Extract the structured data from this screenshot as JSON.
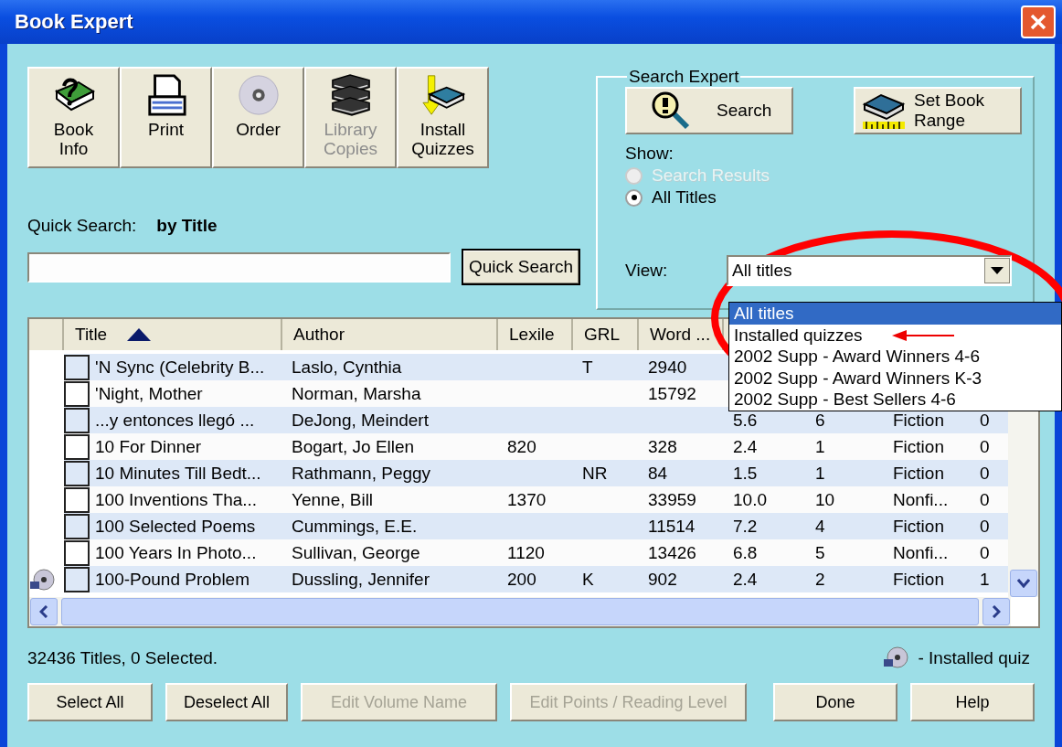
{
  "window": {
    "title": "Book Expert"
  },
  "toolbar": [
    {
      "kind": "book-info",
      "lines": [
        "Book",
        "Info"
      ],
      "disabled": false
    },
    {
      "kind": "print",
      "lines": [
        "Print"
      ],
      "disabled": false
    },
    {
      "kind": "order",
      "lines": [
        "Order"
      ],
      "disabled": false
    },
    {
      "kind": "library",
      "lines": [
        "Library",
        "Copies"
      ],
      "disabled": true
    },
    {
      "kind": "install",
      "lines": [
        "Install",
        "Quizzes"
      ],
      "disabled": false
    }
  ],
  "quick_search": {
    "label": "Quick Search:",
    "mode": "by Title",
    "button": "Quick Search"
  },
  "search_expert": {
    "title": "Search Expert",
    "search_button": "Search",
    "range_button": "Set Book Range",
    "show_label": "Show:",
    "options": [
      {
        "label": "Search Results",
        "selected": false,
        "disabled": true
      },
      {
        "label": "All Titles",
        "selected": true,
        "disabled": false
      }
    ],
    "view_label": "View:",
    "view_value": "All titles",
    "view_options": [
      {
        "label": "All titles",
        "selected": true
      },
      {
        "label": "Installed quizzes",
        "selected": false
      },
      {
        "label": "2002 Supp - Award Winners 4-6",
        "selected": false
      },
      {
        "label": "2002 Supp - Award Winners K-3",
        "selected": false
      },
      {
        "label": "2002 Supp - Best Sellers 4-6",
        "selected": false
      }
    ]
  },
  "table": {
    "columns": [
      {
        "label": "Title",
        "sorted": true
      },
      {
        "label": "Author"
      },
      {
        "label": "Lexile"
      },
      {
        "label": "GRL"
      },
      {
        "label": "Word ..."
      }
    ],
    "rows": [
      {
        "installed": false,
        "checked": false,
        "cells": [
          "'N Sync (Celebrity B...",
          "Laslo, Cynthia",
          null,
          "T",
          "2940",
          null,
          null,
          null,
          null
        ]
      },
      {
        "installed": false,
        "checked": false,
        "cells": [
          "'Night, Mother",
          "Norman, Marsha",
          null,
          null,
          "15792",
          null,
          null,
          null,
          null
        ]
      },
      {
        "installed": false,
        "checked": false,
        "cells": [
          "...y entonces llegó ...",
          "DeJong, Meindert",
          null,
          null,
          null,
          "5.6",
          "6",
          "Fiction",
          "0"
        ]
      },
      {
        "installed": false,
        "checked": false,
        "cells": [
          "10 For Dinner",
          "Bogart, Jo Ellen",
          "820",
          null,
          "328",
          "2.4",
          "1",
          "Fiction",
          "0"
        ]
      },
      {
        "installed": false,
        "checked": false,
        "cells": [
          "10 Minutes Till Bedt...",
          "Rathmann, Peggy",
          null,
          "NR",
          "84",
          "1.5",
          "1",
          "Fiction",
          "0"
        ]
      },
      {
        "installed": false,
        "checked": false,
        "cells": [
          "100 Inventions Tha...",
          "Yenne, Bill",
          "1370",
          null,
          "33959",
          "10.0",
          "10",
          "Nonfi...",
          "0"
        ]
      },
      {
        "installed": false,
        "checked": false,
        "cells": [
          "100 Selected Poems",
          "Cummings, E.E.",
          null,
          null,
          "11514",
          "7.2",
          "4",
          "Fiction",
          "0"
        ]
      },
      {
        "installed": false,
        "checked": false,
        "cells": [
          "100 Years In Photo...",
          "Sullivan, George",
          "1120",
          null,
          "13426",
          "6.8",
          "5",
          "Nonfi...",
          "0"
        ]
      },
      {
        "installed": true,
        "checked": false,
        "cells": [
          "100-Pound Problem",
          "Dussling, Jennifer",
          "200",
          "K",
          "902",
          "2.4",
          "2",
          "Fiction",
          "1"
        ]
      }
    ]
  },
  "status": "32436 Titles, 0 Selected.",
  "legend": "- Installed quiz",
  "buttons": [
    {
      "label": "Select All",
      "disabled": false
    },
    {
      "label": "Deselect All",
      "disabled": false
    },
    {
      "label": "Edit Volume Name",
      "disabled": true
    },
    {
      "label": "Edit Points / Reading Level",
      "disabled": true
    },
    {
      "label": "Done",
      "disabled": false
    },
    {
      "label": "Help",
      "disabled": false
    }
  ]
}
